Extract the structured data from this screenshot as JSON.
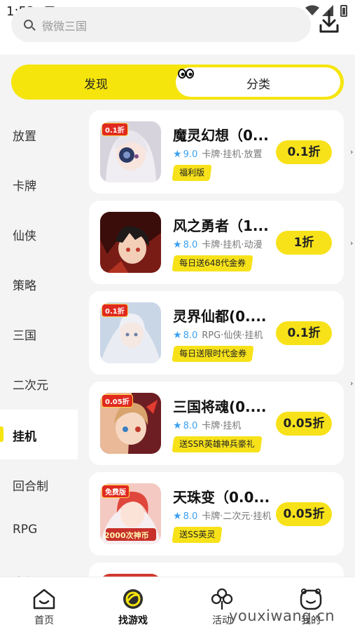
{
  "status": {
    "time": "1:53",
    "a_icon": "A"
  },
  "search": {
    "placeholder": "微微三国"
  },
  "tabs": [
    {
      "label": "发现"
    },
    {
      "label": "分类"
    }
  ],
  "sidebar": {
    "items": [
      {
        "label": "放置"
      },
      {
        "label": "卡牌"
      },
      {
        "label": "仙侠"
      },
      {
        "label": "策略"
      },
      {
        "label": "三国"
      },
      {
        "label": "二次元"
      },
      {
        "label": "挂机",
        "active": true
      },
      {
        "label": "回合制"
      },
      {
        "label": "RPG"
      },
      {
        "label": "魔幻"
      }
    ]
  },
  "games": [
    {
      "title": "魔灵幻想（0...",
      "rating": "9.0",
      "tags": "卡牌·挂机·放置",
      "promo": "福利版",
      "discount": "0.1折",
      "badge": "0.1折"
    },
    {
      "title": "风之勇者（1...",
      "rating": "8.0",
      "tags": "卡牌·挂机·动漫",
      "promo": "每日送648代金券",
      "discount": "1折",
      "badge": ""
    },
    {
      "title": "灵界仙都(0....",
      "rating": "8.0",
      "tags": "RPG·仙侠·挂机",
      "promo": "每日送限时代金券",
      "discount": "0.1折",
      "badge": "0.1折"
    },
    {
      "title": "三国将魂(0....",
      "rating": "8.0",
      "tags": "卡牌·挂机",
      "promo": "送SSR英雄神兵豪礼",
      "discount": "0.05折",
      "badge": "0.05折"
    },
    {
      "title": "天珠变（0.0...",
      "rating": "8.0",
      "tags": "卡牌·二次元·挂机",
      "promo": "送SS英灵",
      "discount": "0.05折",
      "badge": "免费版",
      "badge2": "2000次神币"
    }
  ],
  "nav": [
    {
      "label": "首页",
      "icon": "home-icon"
    },
    {
      "label": "找游戏",
      "icon": "find-game-icon",
      "active": true
    },
    {
      "label": "活动",
      "icon": "activity-clover-icon"
    },
    {
      "label": "我的",
      "icon": "profile-face-icon"
    }
  ],
  "watermark": "youxiwang.cn",
  "colors": {
    "accent": "#f5e50d",
    "rating": "#3aa0f2",
    "badge": "#e02a1f"
  }
}
